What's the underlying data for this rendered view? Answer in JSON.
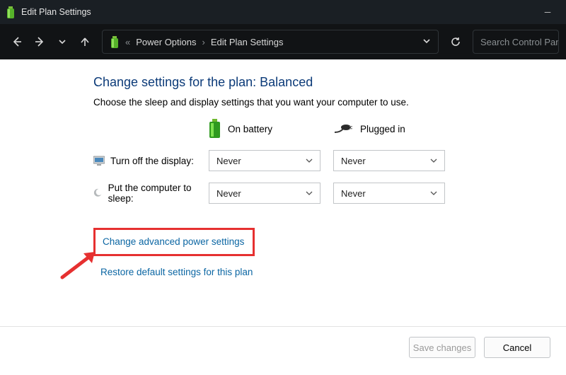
{
  "titlebar": {
    "title": "Edit Plan Settings"
  },
  "breadcrumb": {
    "parent": "Power Options",
    "current": "Edit Plan Settings"
  },
  "search": {
    "placeholder": "Search Control Pane"
  },
  "page": {
    "heading": "Change settings for the plan: Balanced",
    "subtext": "Choose the sleep and display settings that you want your computer to use."
  },
  "columns": {
    "battery": "On battery",
    "plugged": "Plugged in"
  },
  "rows": {
    "display": {
      "label": "Turn off the display:",
      "battery": "Never",
      "plugged": "Never"
    },
    "sleep": {
      "label": "Put the computer to sleep:",
      "battery": "Never",
      "plugged": "Never"
    }
  },
  "links": {
    "advanced": "Change advanced power settings",
    "restore": "Restore default settings for this plan"
  },
  "buttons": {
    "save": "Save changes",
    "cancel": "Cancel"
  }
}
